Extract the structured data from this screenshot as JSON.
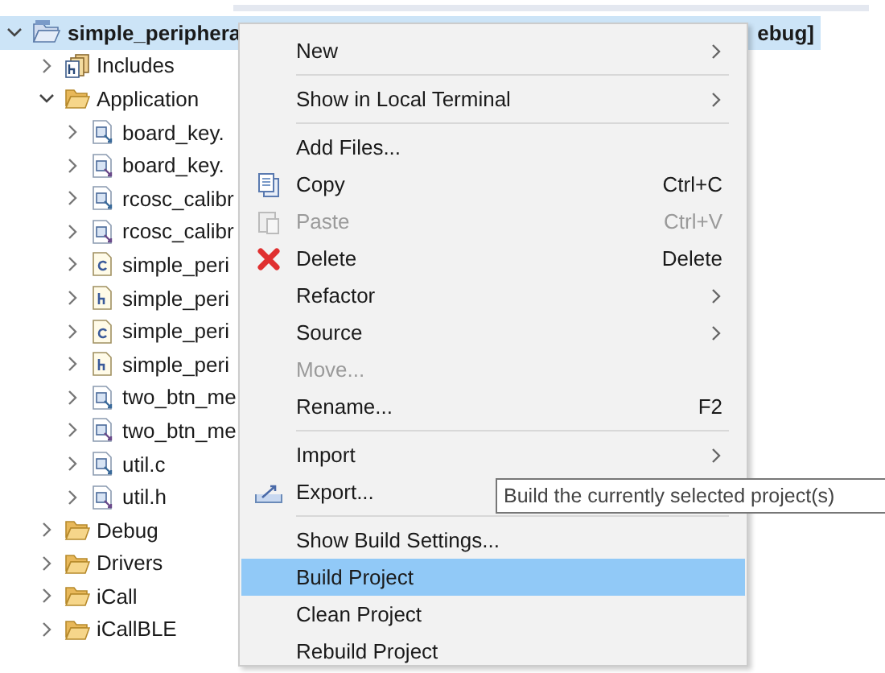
{
  "tree": {
    "project": {
      "name": "simple_periphera",
      "name_tail": "ebug]",
      "selected": true,
      "expanded": true
    },
    "items": [
      {
        "label": "Includes",
        "kind": "includes",
        "expanded": false
      },
      {
        "label": "Application",
        "kind": "folder",
        "expanded": true,
        "children": [
          {
            "label": "board_key.",
            "kind": "source",
            "expanded": false
          },
          {
            "label": "board_key.",
            "kind": "header",
            "expanded": false
          },
          {
            "label": "rcosc_calibr",
            "kind": "source",
            "expanded": false
          },
          {
            "label": "rcosc_calibr",
            "kind": "header",
            "expanded": false
          },
          {
            "label": "simple_peri",
            "kind": "c",
            "expanded": false
          },
          {
            "label": "simple_peri",
            "kind": "h",
            "expanded": false
          },
          {
            "label": "simple_peri",
            "kind": "c",
            "expanded": false
          },
          {
            "label": "simple_peri",
            "kind": "h",
            "expanded": false
          },
          {
            "label": "two_btn_me",
            "kind": "source",
            "expanded": false
          },
          {
            "label": "two_btn_me",
            "kind": "header",
            "expanded": false
          },
          {
            "label": "util.c",
            "kind": "source",
            "expanded": false
          },
          {
            "label": "util.h",
            "kind": "header",
            "expanded": false
          }
        ]
      },
      {
        "label": "Debug",
        "kind": "folder",
        "expanded": false
      },
      {
        "label": "Drivers",
        "kind": "folder",
        "expanded": false
      },
      {
        "label": "iCall",
        "kind": "folder",
        "expanded": false
      },
      {
        "label": "iCallBLE",
        "kind": "folder",
        "expanded": false
      }
    ]
  },
  "context_menu": [
    {
      "kind": "plain",
      "label": "New",
      "submenu": true,
      "disabled": false,
      "selected": false
    },
    {
      "kind": "separator"
    },
    {
      "kind": "plain",
      "label": "Show in Local Terminal",
      "submenu": true,
      "disabled": false,
      "selected": false
    },
    {
      "kind": "separator"
    },
    {
      "kind": "plain",
      "label": "Add Files...",
      "submenu": false,
      "disabled": false,
      "selected": false
    },
    {
      "kind": "copy",
      "label": "Copy",
      "shortcut": "Ctrl+C",
      "submenu": false,
      "disabled": false,
      "selected": false
    },
    {
      "kind": "paste",
      "label": "Paste",
      "shortcut": "Ctrl+V",
      "submenu": false,
      "disabled": true,
      "selected": false
    },
    {
      "kind": "delete",
      "label": "Delete",
      "shortcut": "Delete",
      "submenu": false,
      "disabled": false,
      "selected": false
    },
    {
      "kind": "plain",
      "label": "Refactor",
      "submenu": true,
      "disabled": false,
      "selected": false
    },
    {
      "kind": "plain",
      "label": "Source",
      "submenu": true,
      "disabled": false,
      "selected": false
    },
    {
      "kind": "plain",
      "label": "Move...",
      "submenu": false,
      "disabled": true,
      "selected": false
    },
    {
      "kind": "plain",
      "label": "Rename...",
      "shortcut": "F2",
      "submenu": false,
      "disabled": false,
      "selected": false
    },
    {
      "kind": "separator"
    },
    {
      "kind": "plain",
      "label": "Import",
      "submenu": true,
      "disabled": false,
      "selected": false
    },
    {
      "kind": "export",
      "label": "Export...",
      "disabled": false,
      "selected": false
    },
    {
      "kind": "separator"
    },
    {
      "kind": "plain",
      "label": "Show Build Settings...",
      "submenu": false,
      "disabled": false,
      "selected": false
    },
    {
      "kind": "plain",
      "label": "Build Project",
      "submenu": false,
      "disabled": false,
      "selected": true
    },
    {
      "kind": "plain",
      "label": "Clean Project",
      "submenu": false,
      "disabled": false,
      "selected": false
    },
    {
      "kind": "plain",
      "label": "Rebuild Project",
      "submenu": false,
      "disabled": false,
      "selected": false
    }
  ],
  "tooltip": "Build the currently selected project(s)"
}
